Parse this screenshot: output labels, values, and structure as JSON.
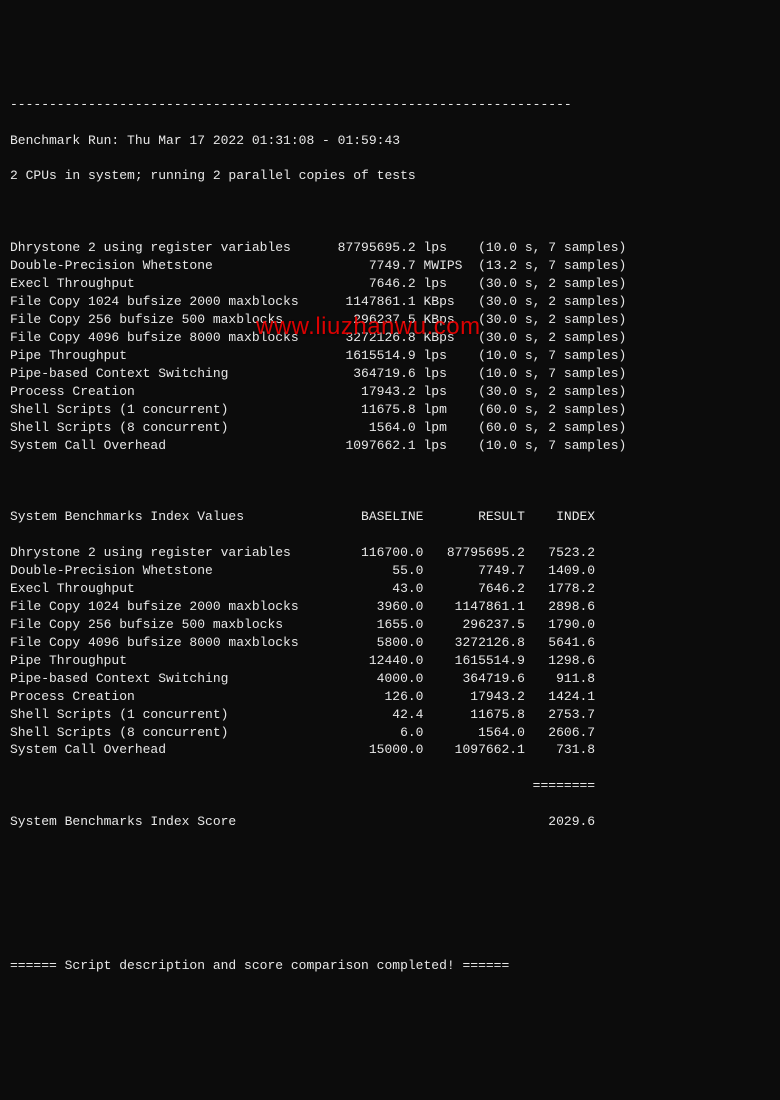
{
  "dashes_top": "------------------------------------------------------------------------",
  "header_run": "Benchmark Run: Thu Mar 17 2022 01:31:08 - 01:59:43",
  "header_cpus": "2 CPUs in system; running 2 parallel copies of tests",
  "results": [
    {
      "name": "Dhrystone 2 using register variables",
      "value": "87795695.2",
      "unit": "lps",
      "time": "10.0",
      "samples": "7"
    },
    {
      "name": "Double-Precision Whetstone",
      "value": "7749.7",
      "unit": "MWIPS",
      "time": "13.2",
      "samples": "7"
    },
    {
      "name": "Execl Throughput",
      "value": "7646.2",
      "unit": "lps",
      "time": "30.0",
      "samples": "2"
    },
    {
      "name": "File Copy 1024 bufsize 2000 maxblocks",
      "value": "1147861.1",
      "unit": "KBps",
      "time": "30.0",
      "samples": "2"
    },
    {
      "name": "File Copy 256 bufsize 500 maxblocks",
      "value": "296237.5",
      "unit": "KBps",
      "time": "30.0",
      "samples": "2"
    },
    {
      "name": "File Copy 4096 bufsize 8000 maxblocks",
      "value": "3272126.8",
      "unit": "KBps",
      "time": "30.0",
      "samples": "2"
    },
    {
      "name": "Pipe Throughput",
      "value": "1615514.9",
      "unit": "lps",
      "time": "10.0",
      "samples": "7"
    },
    {
      "name": "Pipe-based Context Switching",
      "value": "364719.6",
      "unit": "lps",
      "time": "10.0",
      "samples": "7"
    },
    {
      "name": "Process Creation",
      "value": "17943.2",
      "unit": "lps",
      "time": "30.0",
      "samples": "2"
    },
    {
      "name": "Shell Scripts (1 concurrent)",
      "value": "11675.8",
      "unit": "lpm",
      "time": "60.0",
      "samples": "2"
    },
    {
      "name": "Shell Scripts (8 concurrent)",
      "value": "1564.0",
      "unit": "lpm",
      "time": "60.0",
      "samples": "2"
    },
    {
      "name": "System Call Overhead",
      "value": "1097662.1",
      "unit": "lps",
      "time": "10.0",
      "samples": "7"
    }
  ],
  "index_header": "System Benchmarks Index Values               BASELINE       RESULT    INDEX",
  "index_rows": [
    {
      "name": "Dhrystone 2 using register variables",
      "baseline": "116700.0",
      "result": "87795695.2",
      "index": "7523.2"
    },
    {
      "name": "Double-Precision Whetstone",
      "baseline": "55.0",
      "result": "7749.7",
      "index": "1409.0"
    },
    {
      "name": "Execl Throughput",
      "baseline": "43.0",
      "result": "7646.2",
      "index": "1778.2"
    },
    {
      "name": "File Copy 1024 bufsize 2000 maxblocks",
      "baseline": "3960.0",
      "result": "1147861.1",
      "index": "2898.6"
    },
    {
      "name": "File Copy 256 bufsize 500 maxblocks",
      "baseline": "1655.0",
      "result": "296237.5",
      "index": "1790.0"
    },
    {
      "name": "File Copy 4096 bufsize 8000 maxblocks",
      "baseline": "5800.0",
      "result": "3272126.8",
      "index": "5641.6"
    },
    {
      "name": "Pipe Throughput",
      "baseline": "12440.0",
      "result": "1615514.9",
      "index": "1298.6"
    },
    {
      "name": "Pipe-based Context Switching",
      "baseline": "4000.0",
      "result": "364719.6",
      "index": "911.8"
    },
    {
      "name": "Process Creation",
      "baseline": "126.0",
      "result": "17943.2",
      "index": "1424.1"
    },
    {
      "name": "Shell Scripts (1 concurrent)",
      "baseline": "42.4",
      "result": "11675.8",
      "index": "2753.7"
    },
    {
      "name": "Shell Scripts (8 concurrent)",
      "baseline": "6.0",
      "result": "1564.0",
      "index": "2606.7"
    },
    {
      "name": "System Call Overhead",
      "baseline": "15000.0",
      "result": "1097662.1",
      "index": "731.8"
    }
  ],
  "index_dashes": "                                                                   ========",
  "score_label": "System Benchmarks Index Score",
  "score_value": "2029.6",
  "footer": "====== Script description and score comparison completed! ======",
  "watermark": "www.liuzhanwu.com"
}
